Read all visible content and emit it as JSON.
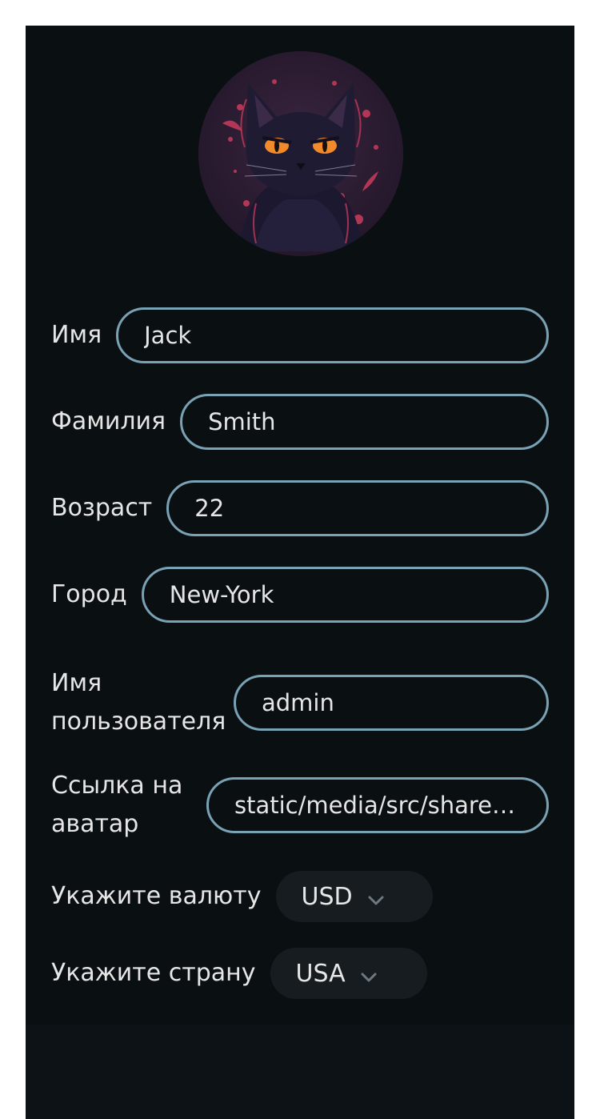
{
  "profile": {
    "avatar_icon": "cat-avatar-icon",
    "fields": [
      {
        "label": "Имя",
        "value": "Jack"
      },
      {
        "label": "Фамилия",
        "value": "Smith"
      },
      {
        "label": "Возраст",
        "value": "22"
      },
      {
        "label": "Город",
        "value": "New-York"
      },
      {
        "label": "Имя пользователя",
        "value": "admin"
      },
      {
        "label": "Ссылка на аватар",
        "value": "static/media/src/shared/..."
      }
    ],
    "currency": {
      "label": "Укажите валюту",
      "value": "USD"
    },
    "country": {
      "label": "Укажите страну",
      "value": "USA"
    }
  },
  "colors": {
    "background": "#0a0f12",
    "field_border": "#7aa2b5",
    "text": "#e6e6e6",
    "select_bg": "#161c20"
  }
}
